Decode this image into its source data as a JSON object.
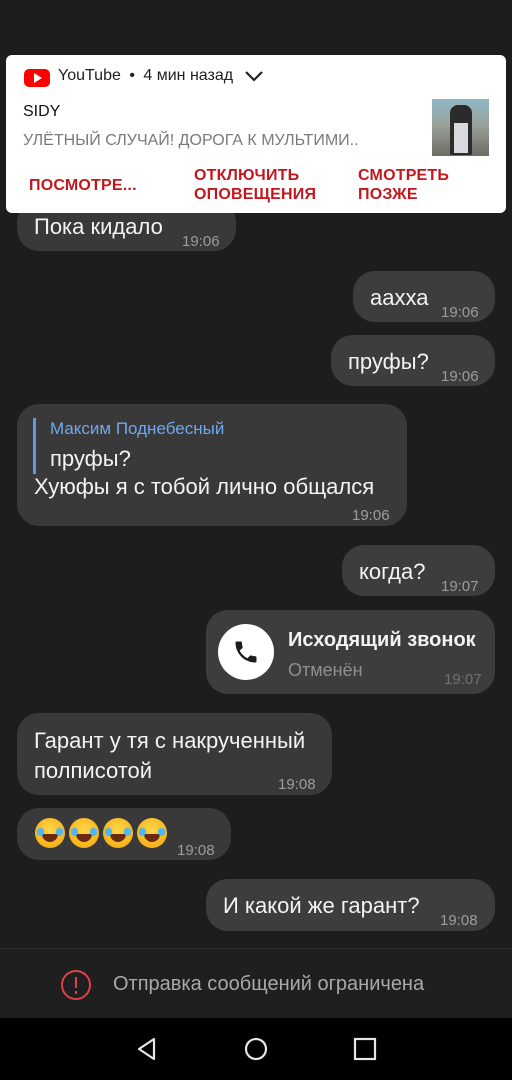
{
  "notification": {
    "app_name": "YouTube",
    "separator": "•",
    "time_ago": "4 мин назад",
    "title": "SIDY",
    "text": "УЛЁТНЫЙ СЛУЧАЙ! ДОРОГА К МУЛЬТИМИ..",
    "actions": [
      {
        "line1": "ПОСМОТРЕ...",
        "line2": ""
      },
      {
        "line1": "ОТКЛЮЧИТЬ",
        "line2": "ОПОВЕЩЕНИЯ"
      },
      {
        "line1": "СМОТРЕТЬ",
        "line2": "ПОЗЖЕ"
      }
    ],
    "accent_color": "#c4171d"
  },
  "messages": [
    {
      "direction": "in",
      "text": "Пока кидало",
      "time": "19:06"
    },
    {
      "direction": "out",
      "text": "аахха",
      "time": "19:06"
    },
    {
      "direction": "out",
      "text": "пруфы?",
      "time": "19:06"
    },
    {
      "direction": "in",
      "reply_author": "Максим Поднебесный",
      "reply_text": "пруфы?",
      "text": "Хуюфы я с тобой лично общался",
      "time": "19:06"
    },
    {
      "direction": "out",
      "text": "когда?",
      "time": "19:07"
    },
    {
      "direction": "out",
      "type": "call",
      "title": "Исходящий звонок",
      "status": "Отменён",
      "time": "19:07",
      "icon": "phone-icon"
    },
    {
      "direction": "in",
      "line1": "Гарант у тя с накрученный",
      "line2": "полписотой",
      "time": "19:08"
    },
    {
      "direction": "in",
      "type": "emoji",
      "emoji": [
        "🤣",
        "🤣",
        "🤣",
        "🤣"
      ],
      "time": "19:08"
    },
    {
      "direction": "out",
      "text": "И какой же гарант?",
      "time": "19:08"
    }
  ],
  "restriction": {
    "text": "Отправка сообщений ограничена",
    "icon": "alert-circle-icon",
    "color": "#e0404a"
  },
  "navbar": {
    "buttons": [
      "back-icon",
      "home-icon",
      "recents-icon"
    ]
  }
}
